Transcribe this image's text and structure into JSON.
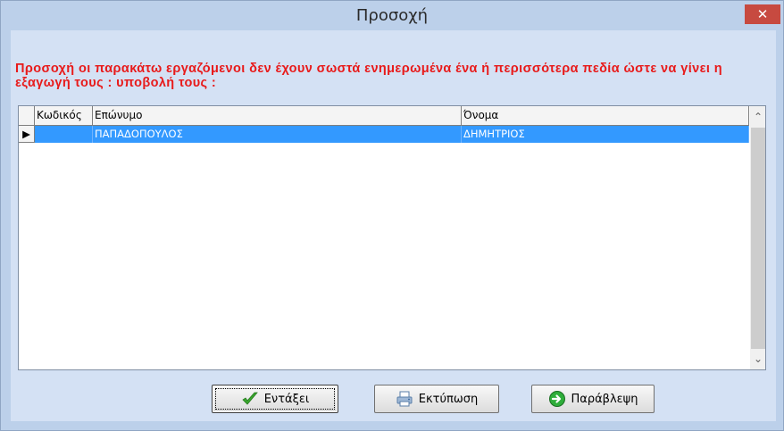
{
  "window": {
    "title": "Προσοχή",
    "close_label": "✕"
  },
  "warning_text": "Προσοχή οι παρακάτω εργαζόμενοι δεν έχουν σωστά ενημερωμένα ένα ή περισσότερα πεδία ώστε να γίνει η εξαγωγή τους : υποβολή τους :",
  "grid": {
    "columns": [
      "Κωδικός",
      "Επώνυμο",
      "Όνομα"
    ],
    "rows": [
      {
        "indicator": "▶",
        "code": "",
        "surname": "ΠΑΠΑΔΟΠΟΥΛΟΣ",
        "name": "ΔΗΜΗΤΡΙΟΣ"
      }
    ],
    "scroll_up": "⌃",
    "scroll_down": "⌄"
  },
  "buttons": {
    "ok_label": "Εντάξει",
    "print_label": "Εκτύπωση",
    "skip_label": "Παράβλεψη"
  },
  "icons": {
    "ok": "checkmark-icon",
    "print": "printer-icon",
    "skip": "arrow-circle-icon"
  },
  "colors": {
    "warning": "#e81a1a",
    "selection": "#3399ff",
    "close": "#c74a40"
  }
}
